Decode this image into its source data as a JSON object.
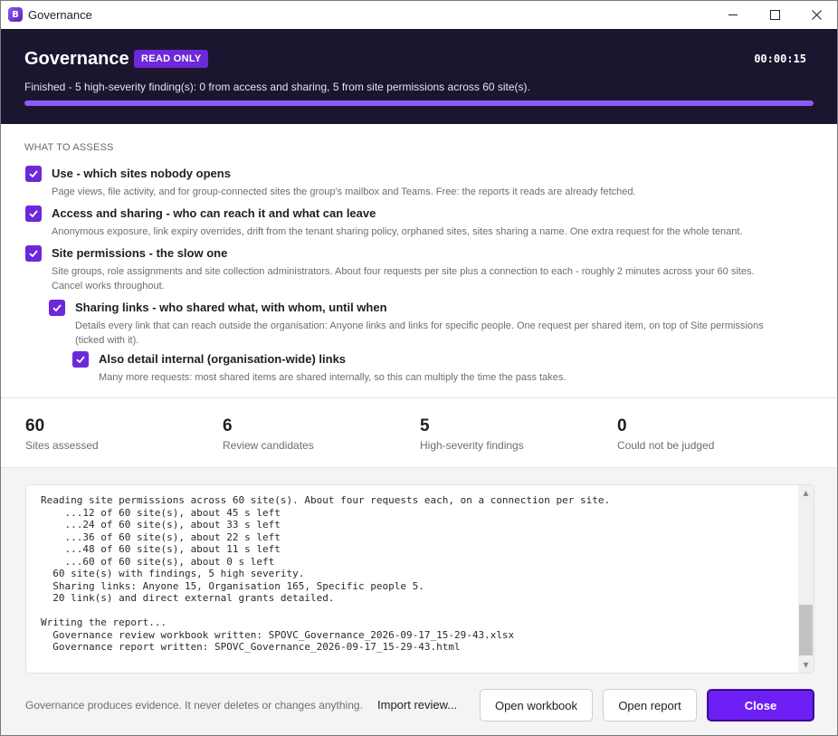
{
  "window": {
    "title": "Governance"
  },
  "header": {
    "title": "Governance",
    "badge": "READ ONLY",
    "timer": "00:00:15",
    "status": "Finished - 5 high-severity finding(s): 0 from access and sharing, 5 from site permissions across 60 site(s).",
    "progress_percent": 100,
    "accent_color": "#6d28d9",
    "background_color": "#1b1530"
  },
  "assess": {
    "label": "WHAT TO ASSESS",
    "options": [
      {
        "checked": true,
        "title": "Use - which sites nobody opens",
        "desc1": "Page views, file activity, and for group-connected sites the group's mailbox and Teams. Free: the reports it reads are already fetched.",
        "desc2": ""
      },
      {
        "checked": true,
        "title": "Access and sharing - who can reach it and what can leave",
        "desc1": "Anonymous exposure, link expiry overrides, drift from the tenant sharing policy, orphaned sites, sites sharing a name. One extra request for the whole tenant.",
        "desc2": ""
      },
      {
        "checked": true,
        "title": "Site permissions - the slow one",
        "desc1": "Site groups, role assignments and site collection administrators. About four requests per site plus a connection to each - roughly 2 minutes across your 60 sites.",
        "desc2": "Cancel works throughout."
      },
      {
        "checked": true,
        "title": "Sharing links - who shared what, with whom, until when",
        "desc1": "Details every link that can reach outside the organisation: Anyone links and links for specific people. One request per shared item, on top of Site permissions",
        "desc2": "(ticked with it)."
      },
      {
        "checked": true,
        "title": "Also detail internal (organisation-wide) links",
        "desc1": "Many more requests: most shared items are shared internally, so this can multiply the time the pass takes.",
        "desc2": ""
      }
    ]
  },
  "stats": [
    {
      "value": "60",
      "label": "Sites assessed"
    },
    {
      "value": "6",
      "label": "Review candidates"
    },
    {
      "value": "5",
      "label": "High-severity findings"
    },
    {
      "value": "0",
      "label": "Could not be judged"
    }
  ],
  "log": {
    "text": "Reading site permissions across 60 site(s). About four requests each, on a connection per site.\n    ...12 of 60 site(s), about 45 s left\n    ...24 of 60 site(s), about 33 s left\n    ...36 of 60 site(s), about 22 s left\n    ...48 of 60 site(s), about 11 s left\n    ...60 of 60 site(s), about 0 s left\n  60 site(s) with findings, 5 high severity.\n  Sharing links: Anyone 15, Organisation 165, Specific people 5.\n  20 link(s) and direct external grants detailed.\n\nWriting the report...\n  Governance review workbook written: SPOVC_Governance_2026-09-17_15-29-43.xlsx\n  Governance report written: SPOVC_Governance_2026-09-17_15-29-43.html"
  },
  "footer": {
    "note": "Governance produces evidence. It never deletes or changes anything.",
    "import_label": "Import review...",
    "workbook_label": "Open workbook",
    "report_label": "Open report",
    "close_label": "Close",
    "primary_color": "#6d1ff5"
  }
}
